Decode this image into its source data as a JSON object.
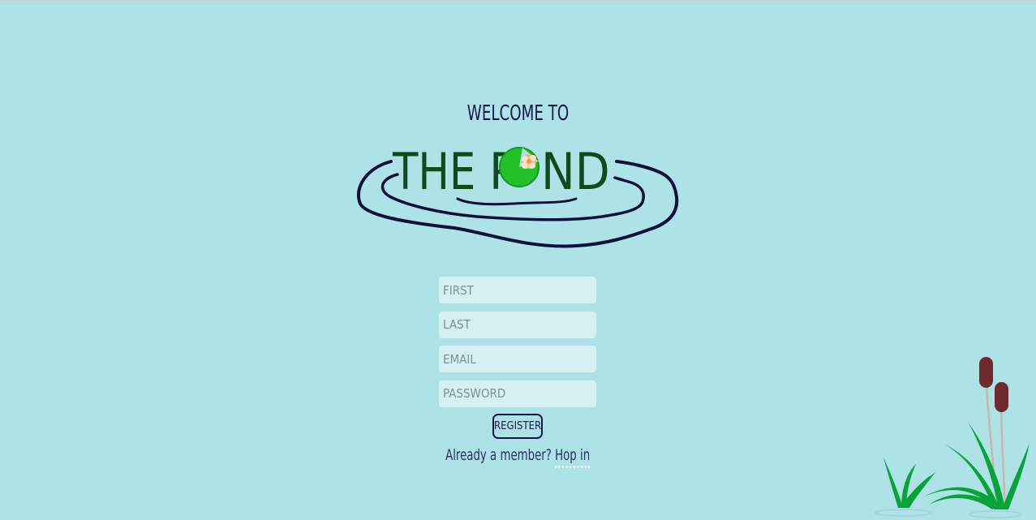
{
  "header": {
    "welcome_text": "Welcome to",
    "logo_text": {
      "the": "THE",
      "p": "P",
      "nd": "ND"
    }
  },
  "form": {
    "first_placeholder": "FIRST",
    "last_placeholder": "LAST",
    "email_placeholder": "EMAIL",
    "password_placeholder": "PASSWORD",
    "register_label": "REGISTER"
  },
  "footer": {
    "already_member_text": "Already a member?",
    "hop_in_label": "Hop in"
  },
  "colors": {
    "background": "#ade2e7",
    "ink": "#17164a",
    "logo_green": "#0d4a1c",
    "lily_pad": "#23c02a",
    "field_bg": "#d5eff2",
    "cattail": "#6e2a2c",
    "grass": "#0aa33a"
  },
  "icons": {
    "lily_pad": "lily-pad-icon",
    "pond_ripples": "pond-ripple-icon",
    "cattails": "cattail-decoration"
  }
}
